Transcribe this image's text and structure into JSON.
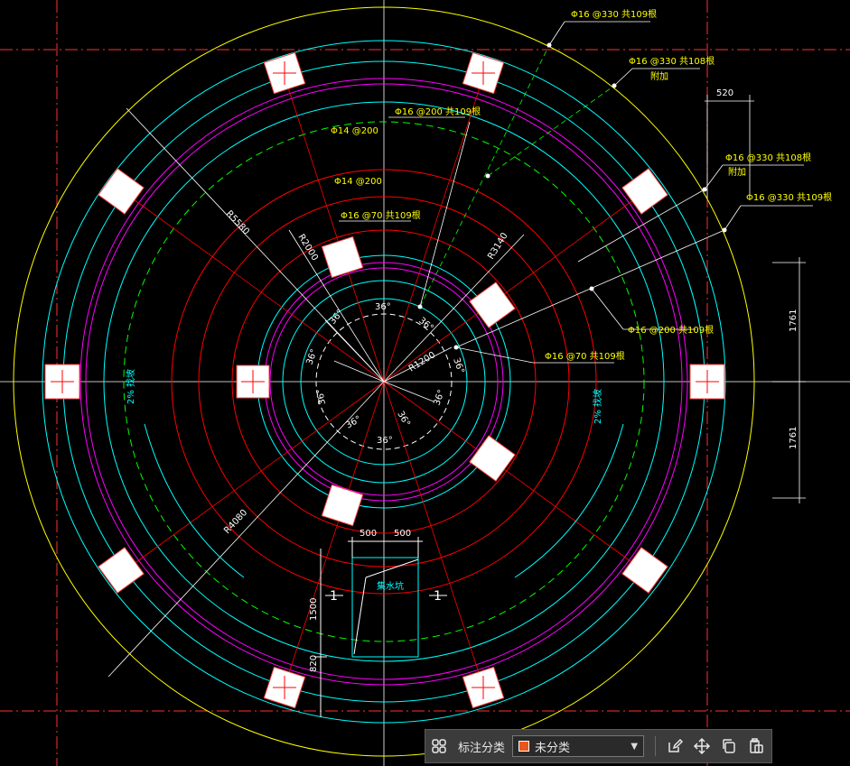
{
  "rebar_labels": {
    "l1": "Φ16 @330 共109根",
    "l2": "Φ16 @330 共108根",
    "l2b": "附加",
    "l3": "Φ16 @200 共109根",
    "l4": "Φ14 @200",
    "l5": "Φ14 @200",
    "l6": "Φ16 @70 共109根",
    "l7": "Φ16 @330 共108根",
    "l7b": "附加",
    "l8": "Φ16 @330 共109根",
    "l9": "Φ16 @200 共109根",
    "l10": "Φ16 @70 共109根"
  },
  "dimensions": {
    "d520": "520",
    "d1761a": "1761",
    "d1761b": "1761",
    "d500a": "500",
    "d500b": "500",
    "d1500": "1500",
    "d820": "820"
  },
  "radii": {
    "r5580": "R5580",
    "r2000": "R2000",
    "r3140": "R3140",
    "r1200": "R1200",
    "r4080": "R4080"
  },
  "angles": {
    "a": "36°"
  },
  "slope_labels": {
    "left": "2%  找坡",
    "right": "2%  找坡"
  },
  "pit": {
    "label": "集水坑",
    "section": "1"
  },
  "toolbar": {
    "category_label": "标注分类",
    "selected_value": "未分类",
    "swatch_color": "#e8571c"
  },
  "colors": {
    "yellow": "#ffff00",
    "cyan": "#00ffff",
    "magenta": "#ff00ff",
    "red": "#ff0000",
    "green": "#00ff00",
    "white": "#ffffff"
  }
}
